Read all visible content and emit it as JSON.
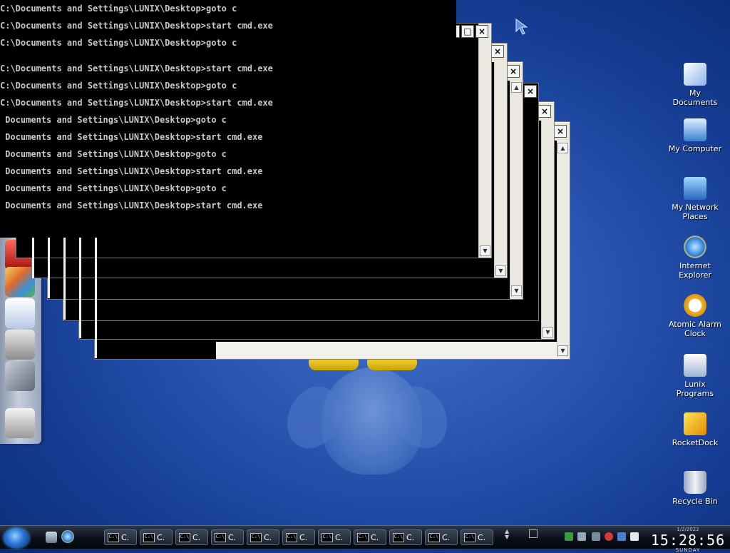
{
  "console": {
    "lines": [
      "C:\\Documents and Settings\\LUNIX\\Desktop>goto c",
      "C:\\Documents and Settings\\LUNIX\\Desktop>start cmd.exe",
      "C:\\Documents and Settings\\LUNIX\\Desktop>goto c",
      "C:\\Documents and Settings\\LUNIX\\Desktop>start cmd.exe",
      "C:\\Documents and Settings\\LUNIX\\Desktop>goto c",
      "C:\\Documents and Settings\\LUNIX\\Desktop>start cmd.exe",
      " Documents and Settings\\LUNIX\\Desktop>goto c",
      " Documents and Settings\\LUNIX\\Desktop>start cmd.exe",
      " Documents and Settings\\LUNIX\\Desktop>goto c",
      " Documents and Settings\\LUNIX\\Desktop>start cmd.exe",
      " Documents and Settings\\LUNIX\\Desktop>goto c",
      " Documents and Settings\\LUNIX\\Desktop>start cmd.exe"
    ]
  },
  "window_buttons": {
    "minimize": "_",
    "maximize": "□",
    "close": "×"
  },
  "desktop_icons": [
    {
      "label": "My Documents",
      "icon": "my-documents-icon"
    },
    {
      "label": "My Computer",
      "icon": "my-computer-icon"
    },
    {
      "label": "My Network Places",
      "icon": "network-places-icon"
    },
    {
      "label": "Internet Explorer",
      "icon": "internet-explorer-icon"
    },
    {
      "label": "Atomic Alarm Clock",
      "icon": "alarm-clock-icon"
    },
    {
      "label": "Lunix Programs",
      "icon": "programs-folder-icon"
    },
    {
      "label": "RocketDock",
      "icon": "rocketdock-icon"
    },
    {
      "label": "Recycle Bin",
      "icon": "recycle-bin-icon"
    }
  ],
  "taskbar": {
    "items": [
      "C.",
      "C.",
      "C.",
      "C.",
      "C.",
      "C.",
      "C.",
      "C.",
      "C.",
      "C.",
      "C."
    ],
    "task_icon_text": "C:\\"
  },
  "clock": {
    "date": "1/2/2022",
    "time": "15:28:56",
    "day": "SUNDAY"
  },
  "colors": {
    "console_bg": "#000000",
    "console_text": "#c8c8c8",
    "desktop": "#2a55b0"
  }
}
